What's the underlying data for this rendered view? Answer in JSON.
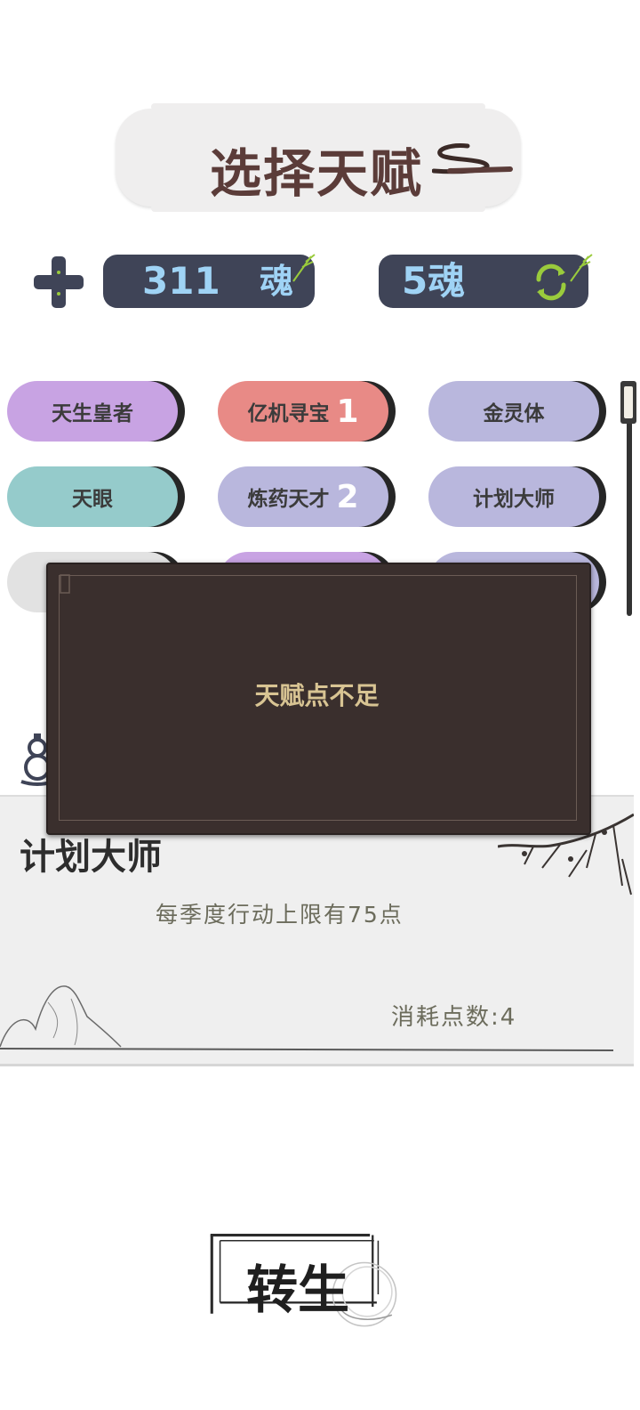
{
  "title": "选择天赋",
  "currency": {
    "soul_amount": "311",
    "soul_unit": "魂",
    "refresh_cost": "5魂"
  },
  "talents": [
    {
      "label": "天生皇者",
      "color": "#c8a3e3",
      "number": ""
    },
    {
      "label": "亿机寻宝",
      "color": "#e88a86",
      "number": "1"
    },
    {
      "label": "金灵体",
      "color": "#b9b7dd",
      "number": ""
    },
    {
      "label": "天眼",
      "color": "#95cbcb",
      "number": ""
    },
    {
      "label": "炼药天才",
      "color": "#b9b7dd",
      "number": "2"
    },
    {
      "label": "计划大师",
      "color": "#b9b7dd",
      "number": ""
    },
    {
      "label": "",
      "color": "#e2e2e2",
      "number": ""
    },
    {
      "label": "",
      "color": "#c8a3e3",
      "number": ""
    },
    {
      "label": "",
      "color": "#b9b7dd",
      "number": ""
    }
  ],
  "description": {
    "title": "计划大师",
    "text": "每季度行动上限有75点",
    "cost": "消耗点数:4"
  },
  "popup": {
    "message": "天赋点不足"
  },
  "rebirth_button": "转生"
}
